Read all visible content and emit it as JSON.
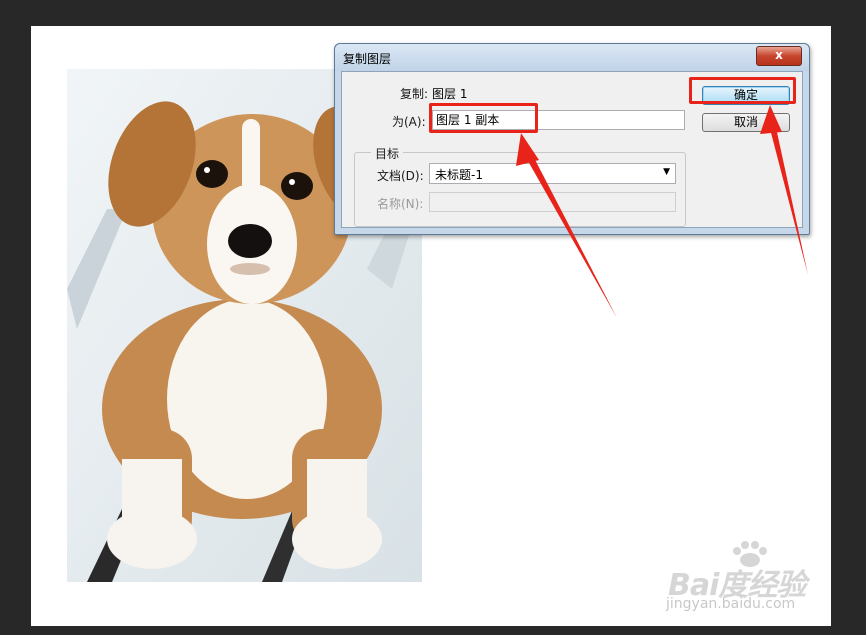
{
  "dialog": {
    "title": "复制图层",
    "close_label": "x",
    "duplicate_label": "复制:",
    "duplicate_value": "图层 1",
    "as_label": "为(A):",
    "as_value": "图层 1 副本",
    "destination_group": "目标",
    "document_label": "文档(D):",
    "document_value": "未标题-1",
    "name_label": "名称(N):",
    "name_value": "",
    "ok_label": "确定",
    "cancel_label": "取消"
  },
  "watermark": {
    "logo_text": "Bai度经验",
    "site_text": "jingyan.baidu.com"
  },
  "colors": {
    "annotation": "#e8231a",
    "workspace": "#282828",
    "dialog_frame": "#c6d7ea"
  }
}
